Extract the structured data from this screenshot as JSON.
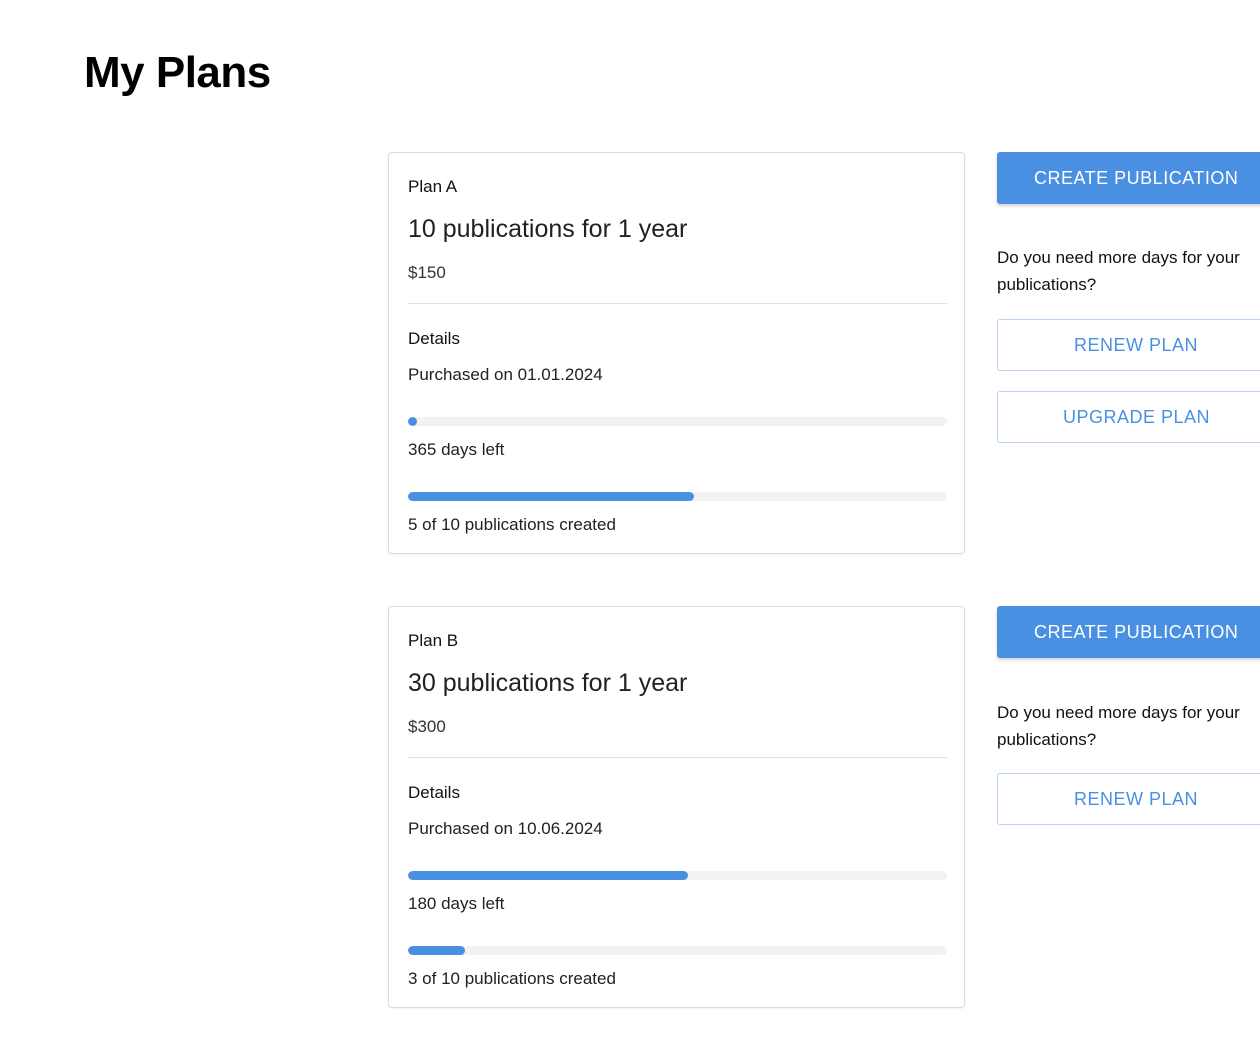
{
  "page": {
    "title": "My Plans"
  },
  "plans": [
    {
      "name": "Plan A",
      "headline": "10 publications for 1 year",
      "price": "$150",
      "details_label": "Details",
      "purchased": "Purchased on 01.01.2024",
      "days_left_text": "365 days left",
      "days_progress_percent": 1,
      "publications_text": "5 of 10 publications created",
      "publications_progress_percent": 53,
      "actions": {
        "create_label": "CREATE PUBLICATION",
        "prompt": "Do you need more days for your publications?",
        "renew_label": "RENEW PLAN",
        "upgrade_label": "UPGRADE PLAN"
      }
    },
    {
      "name": "Plan B",
      "headline": "30 publications for 1 year",
      "price": "$300",
      "details_label": "Details",
      "purchased": "Purchased on 10.06.2024",
      "days_left_text": "180 days left",
      "days_progress_percent": 52,
      "publications_text": "3 of 10 publications created",
      "publications_progress_percent": 10.5,
      "actions": {
        "create_label": "CREATE PUBLICATION",
        "prompt": "Do you need more days for your publications?",
        "renew_label": "RENEW PLAN"
      }
    }
  ],
  "colors": {
    "accent": "#4a90e2",
    "track": "#f2f2f2",
    "border": "#dcdcdc"
  }
}
